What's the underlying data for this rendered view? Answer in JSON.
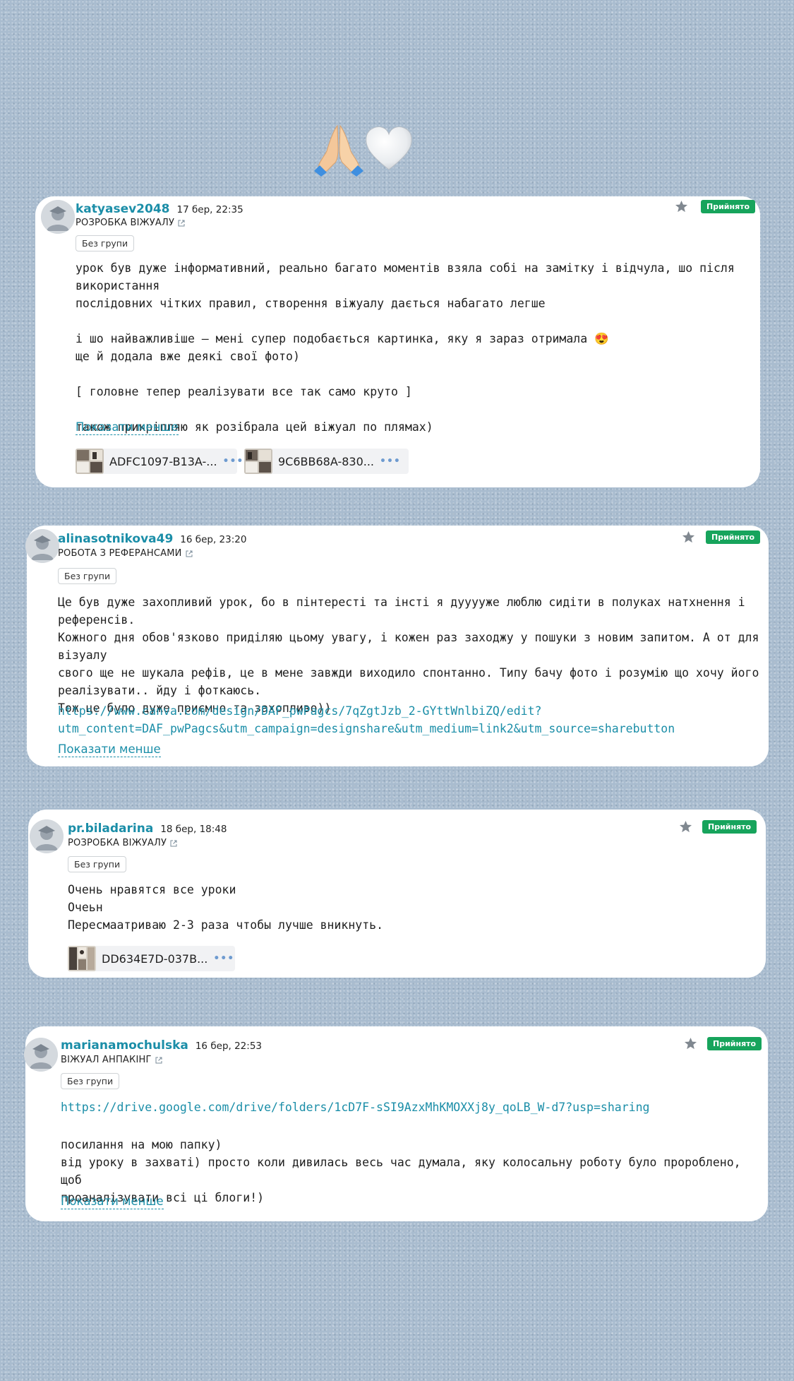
{
  "header": {
    "emoji_hands": "praying-hands",
    "emoji_heart": "white-heart"
  },
  "status_label": "Прийнято",
  "comments": [
    {
      "username": "katyasev2048",
      "date": "17 бер, 22:35",
      "lesson": "РОЗРОБКА ВІЖУАЛУ",
      "group": "Без групи",
      "text": "урок був дуже інформативний, реально багато моментів взяла собі на замітку і відчула, шо після використання\nпослідовних чітких правил, створення віжуалу дається набагато легше\n\nі шо найважливіше — мені супер подобається картинка, яку я зараз отримала 😍\nще й додала вже деякі свої фото)\n\n[ головне тепер реалізувати все так само круто ]\n\nтакож прикріпляю як розібрала цей віжуал по плямах)",
      "toggle": "Показати менше",
      "attachments": [
        {
          "name": "ADFC1097-B13A-..."
        },
        {
          "name": "9C6BB68A-830..."
        }
      ]
    },
    {
      "username": "alinasotnikova49",
      "date": "16 бер, 23:20",
      "lesson": "РОБОТА З РЕФЕРАНСАМИ",
      "group": "Без групи",
      "text": "Це був дуже захопливий урок, бо в пінтересті та інсті я дууууже люблю сидіти в полуках натхнення і референсів.\nКожного дня обов'язково приділяю цьому увагу, і кожен раз заходжу у пошуки з новим запитом. А от для візуалу\nсвого ще не шукала рефів, це в мене завжди виходило спонтанно. Типу бачу фото і розумію що хочу його\nреалізувати.. йду і фоткаюсь.\nТож це було дуже приємно та захопливо))",
      "link": "https://www.canva.com/design/DAF_pwPagcs/7qZgtJzb_2-GYttWnlbiZQ/edit?\nutm_content=DAF_pwPagcs&utm_campaign=designshare&utm_medium=link2&utm_source=sharebutton",
      "toggle": "Показати менше"
    },
    {
      "username": "pr.biladarina",
      "date": "18 бер, 18:48",
      "lesson": "РОЗРОБКА ВІЖУАЛУ",
      "group": "Без групи",
      "text": "Очень нравятся все уроки\nОчеьн\nПересмаатриваю 2-3 раза чтобы лучше вникнуть.",
      "attachments": [
        {
          "name": "DD634E7D-037B..."
        }
      ]
    },
    {
      "username": "marianamochulska",
      "date": "16 бер, 22:53",
      "lesson": "ВІЖУАЛ АНПАКІНГ",
      "group": "Без групи",
      "link": "https://drive.google.com/drive/folders/1cD7F-sSI9AzxMhKMOXXj8y_qoLB_W-d7?usp=sharing",
      "text": "посилання на мою папку)\nвід уроку в захваті) просто коли дивилась весь час думала, яку колосальну роботу було пророблено, щоб\nпроаналізувати всі ці блоги!)",
      "toggle": "Показати менше"
    }
  ]
}
